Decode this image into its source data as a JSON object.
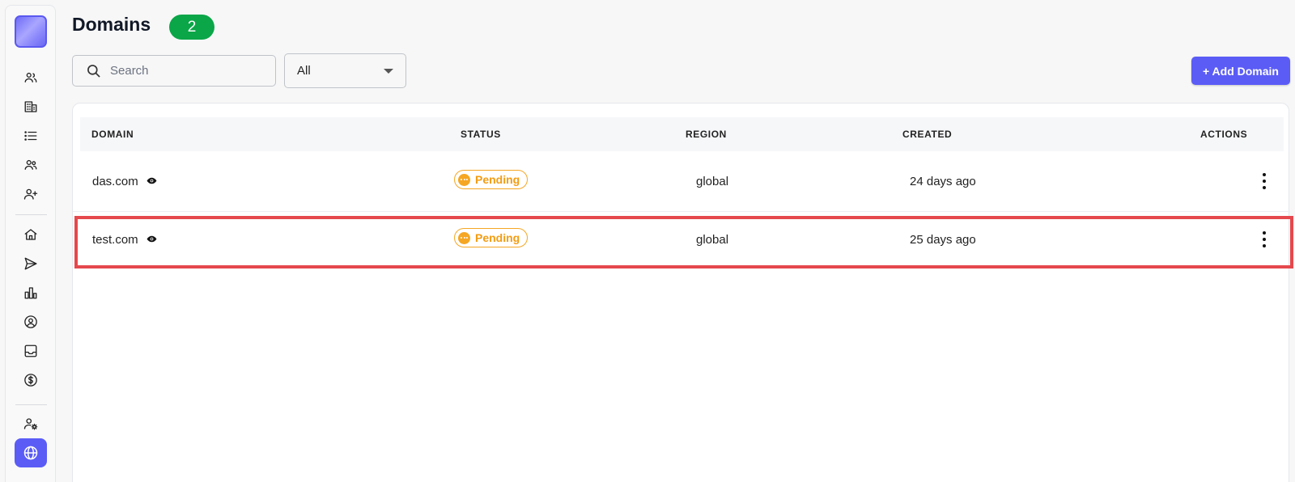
{
  "header": {
    "title": "Domains",
    "count": "2"
  },
  "filters": {
    "search_placeholder": "Search",
    "status_filter": "All"
  },
  "toolbar": {
    "add_label": "+ Add Domain"
  },
  "table": {
    "columns": [
      "DOMAIN",
      "STATUS",
      "REGION",
      "CREATED",
      "ACTIONS"
    ],
    "rows": [
      {
        "domain": "das.com",
        "status": "Pending",
        "region": "global",
        "created": "24 days ago"
      },
      {
        "domain": "test.com",
        "status": "Pending",
        "region": "global",
        "created": "25 days ago"
      }
    ]
  },
  "sidebar": {
    "icons": [
      "users-icon",
      "building-icon",
      "list-icon",
      "team-icon",
      "user-plus-icon",
      "home-icon",
      "send-icon",
      "bar-chart-icon",
      "user-circle-icon",
      "inbox-icon",
      "dollar-icon",
      "user-settings-icon",
      "globe-icon"
    ]
  },
  "colors": {
    "accent": "#5b5cf6",
    "badge": "#0aa648",
    "pending": "#f5a623",
    "highlight": "#e5484d"
  }
}
